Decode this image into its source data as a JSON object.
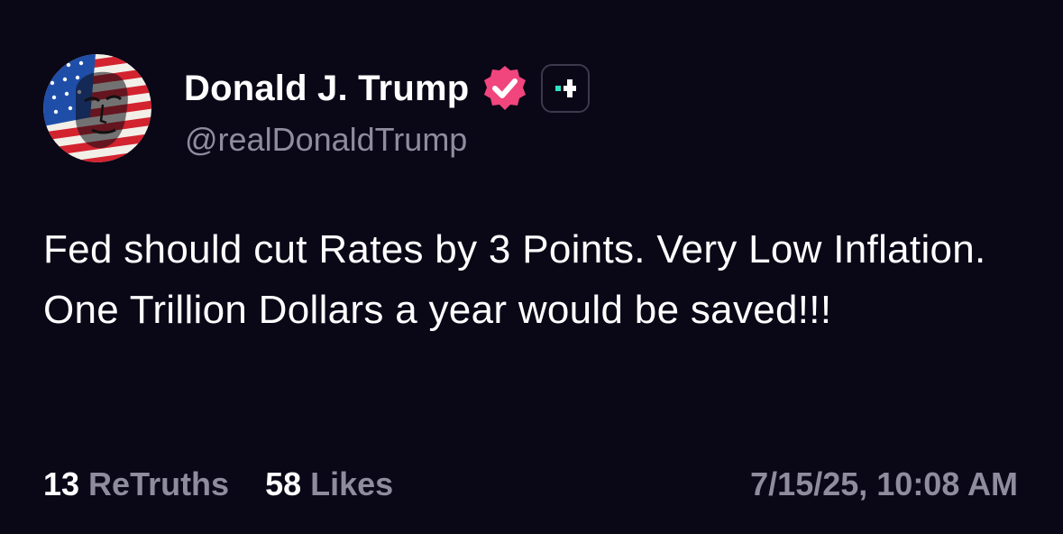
{
  "author": {
    "display_name": "Donald J. Trump",
    "handle": "@realDonaldTrump",
    "avatar_icon": "flag-portrait-avatar",
    "verified_icon": "verified-check-icon",
    "plus_icon": "truth-plus-icon"
  },
  "post": {
    "text": "Fed should cut Rates by 3 Points. Very Low Inflation. One Trillion Dollars a year would be saved!!!"
  },
  "stats": {
    "retruths_count": "13",
    "retruths_label": "ReTruths",
    "likes_count": "58",
    "likes_label": "Likes"
  },
  "timestamp": "7/15/25, 10:08 AM",
  "colors": {
    "background": "#0a0717",
    "text_primary": "#ffffff",
    "text_secondary": "#8f8c9e",
    "verified_badge": "#f0457d",
    "plus_accent": "#2ee3c4"
  }
}
